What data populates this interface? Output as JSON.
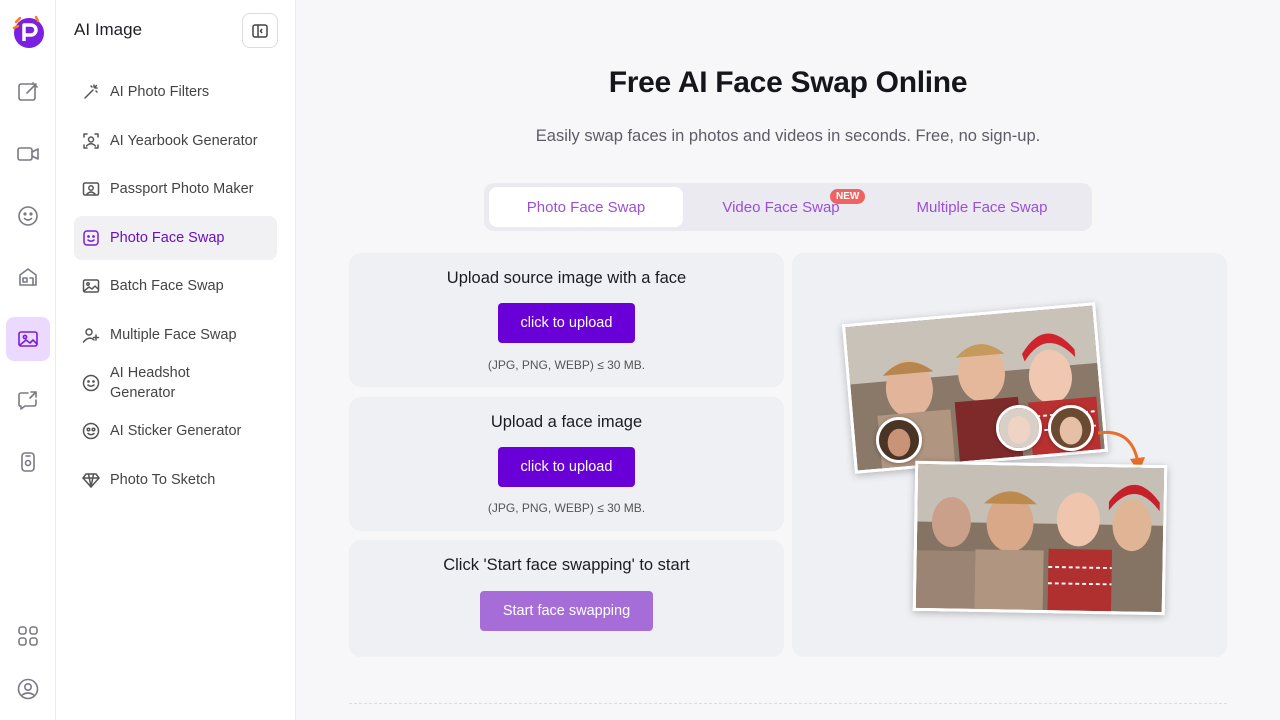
{
  "sidebar": {
    "title": "AI Image",
    "items": [
      {
        "label": "AI Photo Filters",
        "icon": "magic-wand-icon"
      },
      {
        "label": "AI Yearbook Generator",
        "icon": "portrait-frame-icon"
      },
      {
        "label": "Passport Photo Maker",
        "icon": "id-card-icon"
      },
      {
        "label": "Photo Face Swap",
        "icon": "face-swap-icon",
        "active": true
      },
      {
        "label": "Batch Face Swap",
        "icon": "image-stack-icon"
      },
      {
        "label": "Multiple Face Swap",
        "icon": "user-add-icon"
      },
      {
        "label": "AI Headshot Generator",
        "icon": "smile-icon"
      },
      {
        "label": "AI Sticker Generator",
        "icon": "sticker-face-icon"
      },
      {
        "label": "Photo To Sketch",
        "icon": "diamond-icon"
      }
    ]
  },
  "main": {
    "title": "Free AI Face Swap Online",
    "subtitle": "Easily swap faces in photos and videos in seconds. Free, no sign-up.",
    "tabs": [
      {
        "label": "Photo Face Swap",
        "active": true
      },
      {
        "label": "Video Face Swap",
        "badge": "NEW"
      },
      {
        "label": "Multiple Face Swap"
      }
    ],
    "source_card": {
      "title": "Upload source image with a face",
      "button": "click to upload",
      "note": "(JPG, PNG, WEBP) ≤ 30 MB."
    },
    "face_card": {
      "title": "Upload a face image",
      "button": "click to upload",
      "note": "(JPG, PNG, WEBP) ≤ 30 MB."
    },
    "start_card": {
      "title": "Click 'Start face swapping' to start",
      "button": "Start face swapping"
    }
  },
  "colors": {
    "accent": "#6a00d8",
    "accent_light": "#a66dd8",
    "tab_text": "#9b4fd6",
    "badge": "#f06363"
  }
}
